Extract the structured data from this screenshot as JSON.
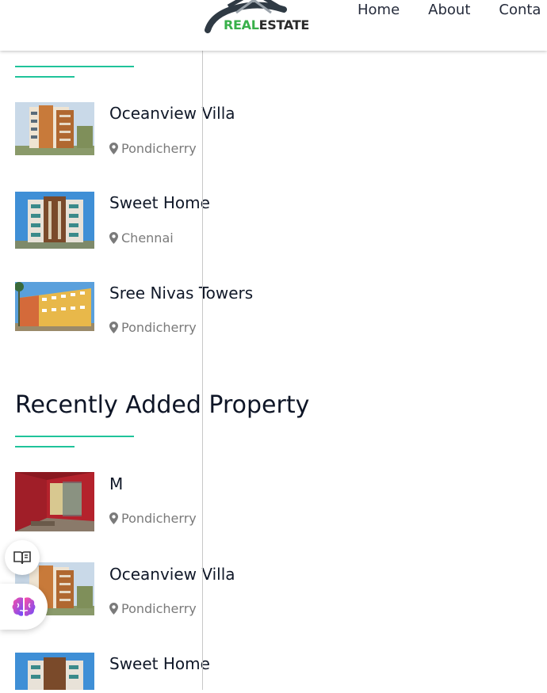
{
  "header": {
    "logo": {
      "real": "REAL",
      "estate": "ESTATE"
    },
    "nav": [
      "Home",
      "About",
      "Conta"
    ]
  },
  "featured": {
    "items": [
      {
        "title": "Oceanview Villa",
        "location": "Pondicherry"
      },
      {
        "title": "Sweet Home",
        "location": "Chennai"
      },
      {
        "title": "Sree Nivas Towers",
        "location": "Pondicherry"
      }
    ]
  },
  "recent": {
    "heading": "Recently Added Property",
    "items": [
      {
        "title": "M",
        "location": "Pondicherry"
      },
      {
        "title": "Oceanview Villa",
        "location": "Pondicherry"
      },
      {
        "title": "Sweet Home",
        "location": ""
      }
    ]
  },
  "colors": {
    "accent": "#1fc39a",
    "logo_green": "#38b04a",
    "text": "#101828",
    "muted": "#7a7a7a"
  },
  "icons": [
    "map-marker-icon",
    "reader-mode-icon",
    "brain-icon"
  ]
}
